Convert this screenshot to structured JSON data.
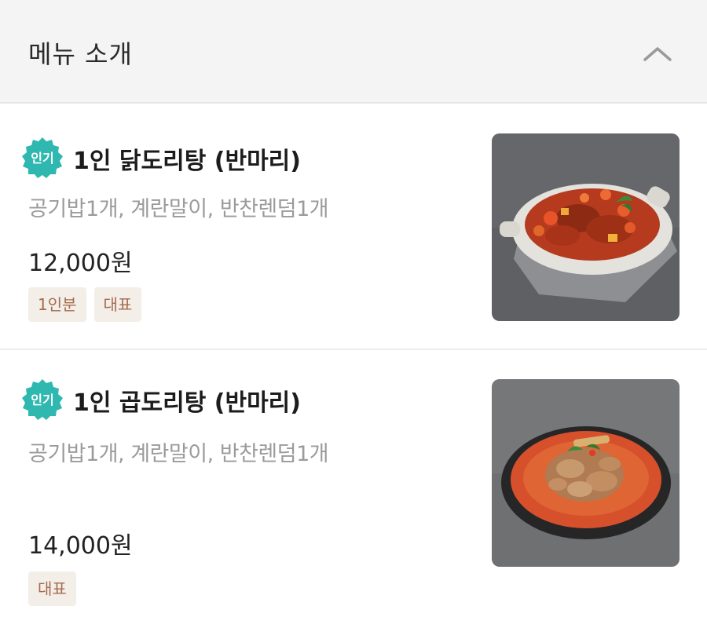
{
  "header": {
    "title": "메뉴 소개",
    "collapse_icon": "chevron-up-icon"
  },
  "menu_items": [
    {
      "badge": "인기",
      "name": "1인 닭도리탕 (반마리)",
      "description": "공기밥1개, 계란말이, 반찬렌덤1개",
      "price": "12,000원",
      "tags": [
        "1인분",
        "대표"
      ],
      "image": "braised-chicken-dish-photo"
    },
    {
      "badge": "인기",
      "name": "1인 곱도리탕 (반마리)",
      "description": "공기밥1개, 계란말이, 반찬렌덤1개",
      "price": "14,000원",
      "tags": [
        "대표"
      ],
      "image": "spicy-chicken-stew-photo"
    }
  ],
  "colors": {
    "badge": "#2fb8b0",
    "tag_bg": "#f4eee9",
    "tag_text": "#a56b4e",
    "header_bg": "#f4f4f4"
  }
}
